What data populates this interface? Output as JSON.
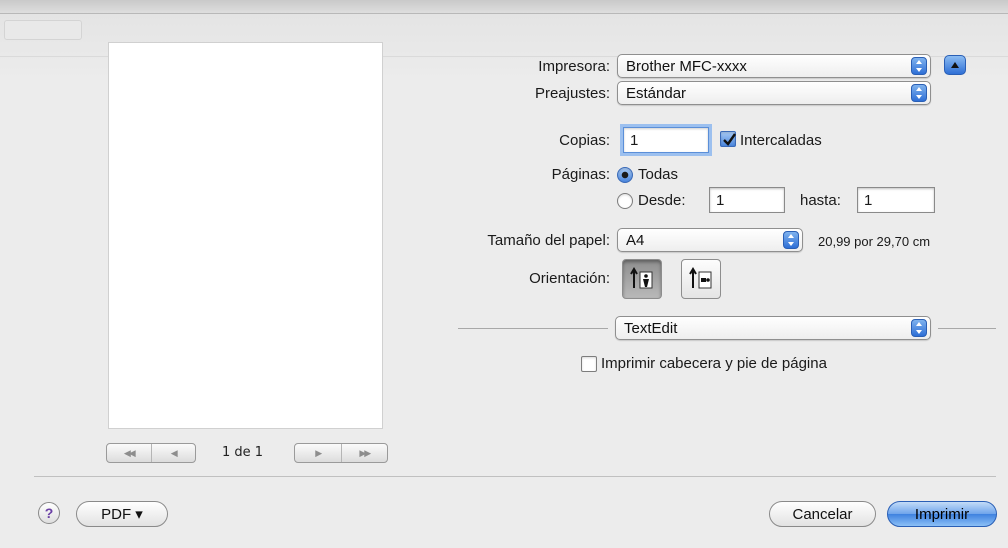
{
  "printer": {
    "label": "Impresora:",
    "value": "Brother MFC-xxxx"
  },
  "presets": {
    "label": "Preajustes:",
    "value": "Estándar"
  },
  "copies": {
    "label": "Copias:",
    "value": "1",
    "collated_label": "Intercaladas",
    "collated_checked": true
  },
  "pages": {
    "label": "Páginas:",
    "all_label": "Todas",
    "range_label": "Desde:",
    "from_value": "1",
    "to_label": "hasta:",
    "to_value": "1",
    "selected": "all"
  },
  "paper_size": {
    "label": "Tamaño del papel:",
    "value": "A4",
    "dimensions": "20,99 por 29,70 cm"
  },
  "orientation": {
    "label": "Orientación:",
    "selected": "portrait"
  },
  "app_section": {
    "value": "TextEdit",
    "header_footer_label": "Imprimir cabecera y pie de página",
    "header_footer_checked": false
  },
  "preview": {
    "page_indicator": "1 de 1"
  },
  "footer": {
    "help_glyph": "?",
    "pdf_label": "PDF ▾",
    "cancel_label": "Cancelar",
    "print_label": "Imprimir"
  },
  "colors": {
    "accent": "#3f82e0",
    "background": "#ececec"
  }
}
